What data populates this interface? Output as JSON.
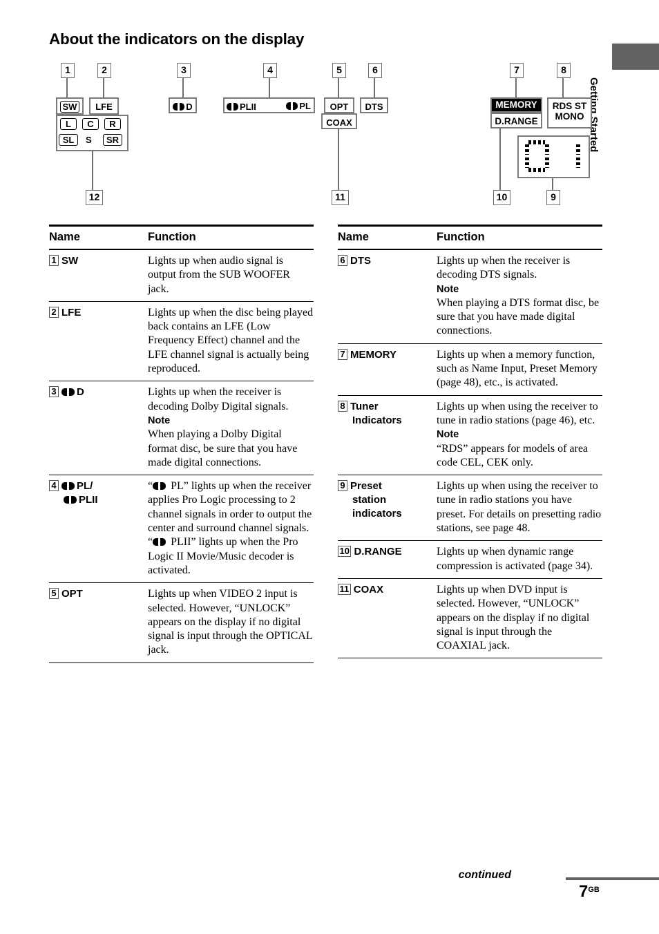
{
  "page": {
    "title": "About the indicators on the display",
    "side_tab_label": "Getting Started",
    "footer_continued": "continued",
    "page_number": "7",
    "page_number_sup": "GB"
  },
  "diagram": {
    "callouts": [
      "1",
      "2",
      "3",
      "4",
      "5",
      "6",
      "7",
      "8",
      "9",
      "10",
      "11",
      "12"
    ],
    "display_items": {
      "sw": "SW",
      "lfe": "LFE",
      "l": "L",
      "c": "C",
      "r": "R",
      "sl": "SL",
      "s": "S",
      "sr": "SR",
      "dolby_d": "D",
      "dolby_plii": "PLII",
      "dolby_pl": "PL",
      "opt": "OPT",
      "coax": "COAX",
      "dts": "DTS",
      "memory": "MEMORY",
      "drange": "D.RANGE",
      "rds_st": "RDS ST",
      "mono": "MONO",
      "preset_value": "01"
    }
  },
  "tables": {
    "headers": {
      "name": "Name",
      "function": "Function"
    },
    "left_rows": [
      {
        "num": "1",
        "name": "SW",
        "name_has_dolby": false,
        "function": "Lights up when audio signal is output from the SUB WOOFER jack."
      },
      {
        "num": "2",
        "name": "LFE",
        "name_has_dolby": false,
        "function": "Lights up when the disc being played back contains an LFE (Low Frequency Effect) channel and the LFE channel signal is actually being reproduced."
      },
      {
        "num": "3",
        "name": "D",
        "name_has_dolby": true,
        "function_part1": "Lights up when the receiver is decoding Dolby Digital signals.",
        "note_label": "Note",
        "function_part2": "When playing a Dolby Digital format disc, be sure that you have made digital connections."
      },
      {
        "num": "4",
        "name": "PL/",
        "name_sub": "PLII",
        "name_has_dolby": true,
        "function_a_pre": "“",
        "function_a_post": " PL” lights up when the receiver applies Pro Logic processing to 2 channel signals in order to output the center and surround channel signals.",
        "function_b_pre": "“",
        "function_b_post": " PLII” lights up when the Pro Logic II Movie/Music decoder is activated."
      },
      {
        "num": "5",
        "name": "OPT",
        "name_has_dolby": false,
        "function": "Lights up when VIDEO 2 input is selected. However, “UNLOCK” appears on the display if no digital signal is input through the OPTICAL jack."
      }
    ],
    "right_rows": [
      {
        "num": "6",
        "name": "DTS",
        "function_part1": "Lights up when the receiver is decoding DTS signals.",
        "note_label": "Note",
        "function_part2": "When playing a DTS format disc, be sure that you have made digital connections."
      },
      {
        "num": "7",
        "name": "MEMORY",
        "function": "Lights up when a memory function, such as Name Input, Preset Memory (page 48), etc., is activated."
      },
      {
        "num": "8",
        "name": "Tuner",
        "name_sub": "Indicators",
        "function_part1": "Lights up when using the receiver to tune in radio stations (page 46), etc.",
        "note_label": "Note",
        "function_part2": "“RDS” appears for models of area code CEL, CEK only."
      },
      {
        "num": "9",
        "name": "Preset",
        "name_sub": "station",
        "name_sub2": "indicators",
        "function": "Lights up when using the receiver to tune in radio stations you have preset. For details on presetting radio stations, see page 48."
      },
      {
        "num": "10",
        "name": "D.RANGE",
        "function": "Lights up when dynamic range compression is activated (page 34)."
      },
      {
        "num": "11",
        "name": "COAX",
        "function": "Lights up when DVD input is selected. However, “UNLOCK” appears on the display if no digital signal is input through the COAXIAL jack."
      }
    ]
  },
  "colors": {
    "tab_gray": "#636363",
    "box_gray": "#7a7a7a",
    "leader_gray": "#6e6e6e",
    "black": "#000000"
  }
}
